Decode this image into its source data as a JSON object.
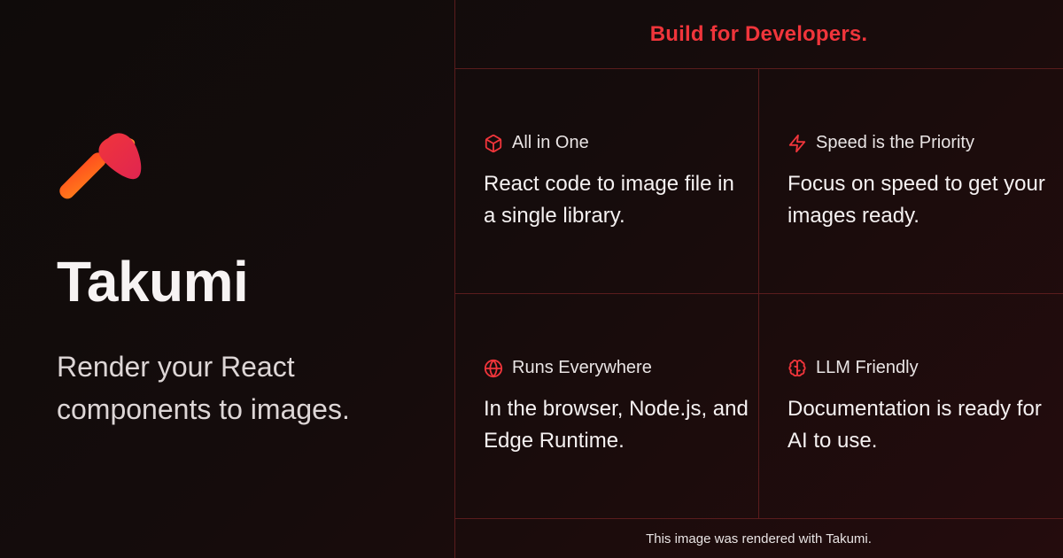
{
  "brand": {
    "name": "Takumi",
    "tagline": "Render your React components to images.",
    "logo_icon": "hammer-icon"
  },
  "header": {
    "text": "Build for Developers."
  },
  "features": [
    {
      "icon": "cube-icon",
      "title": "All in One",
      "description": "React code to image file in a single library."
    },
    {
      "icon": "lightning-icon",
      "title": "Speed is the Priority",
      "description": "Focus on speed to get your images ready."
    },
    {
      "icon": "globe-icon",
      "title": "Runs Everywhere",
      "description": "In the browser, Node.js, and Edge Runtime."
    },
    {
      "icon": "brain-icon",
      "title": "LLM Friendly",
      "description": "Documentation is ready for AI to use."
    }
  ],
  "footer": {
    "text": "This image was rendered with Takumi."
  },
  "colors": {
    "accent": "#f0353b",
    "grid_line": "#5a1c1d",
    "background_dark": "#0f0b0a",
    "background_red": "#240c0d"
  }
}
